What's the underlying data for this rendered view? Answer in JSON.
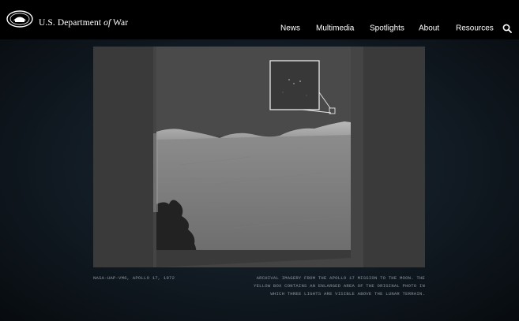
{
  "header": {
    "site_title_prefix": "U.S. Department ",
    "site_title_of": "of",
    "site_title_suffix": " War",
    "logo_icon": "department-seal",
    "search_icon": "magnifier"
  },
  "nav": {
    "items": [
      "News",
      "Multimedia",
      "Spotlights",
      "About",
      "Resources"
    ]
  },
  "photo": {
    "credit": "NASA-UAP-VM6, APOLLO 17, 1972",
    "caption_lines": [
      "ARCHIVAL IMAGERY FROM THE APOLLO 17 MISSION TO THE MOON. THE",
      "YELLOW BOX CONTAINS AN ENLARGED AREA OF THE ORIGINAL PHOTO IN",
      "WHICH THREE LIGHTS ARE VISIBLE ABOVE THE LUNAR TERRAIN."
    ]
  },
  "colors": {
    "header_bg": "#000000",
    "viewer_bg": "#111a22",
    "caption_text": "#8e969c"
  }
}
